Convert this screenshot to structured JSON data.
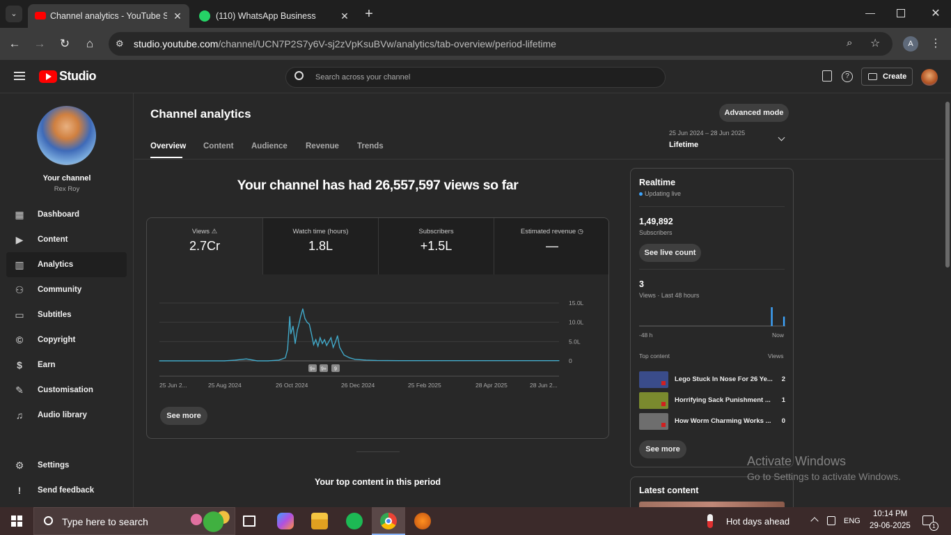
{
  "browser": {
    "tabs": [
      {
        "title": "Channel analytics - YouTube Stu",
        "close": "✕"
      },
      {
        "title": "(110) WhatsApp Business",
        "close": "✕"
      }
    ],
    "new_tab": "+",
    "url_host": "studio.youtube.com",
    "url_path": "/channel/UCN7P2S7y6V-sj2zVpKsuBVw/analytics/tab-overview/period-lifetime",
    "profile_letter": "A"
  },
  "header": {
    "logo_text": "Studio",
    "search_placeholder": "Search across your channel",
    "create_label": "Create"
  },
  "sidebar": {
    "channel_title": "Your channel",
    "channel_name": "Rex Roy",
    "items": [
      {
        "label": "Dashboard",
        "icon": "dashboard-icon"
      },
      {
        "label": "Content",
        "icon": "content-icon"
      },
      {
        "label": "Analytics",
        "icon": "analytics-icon"
      },
      {
        "label": "Community",
        "icon": "community-icon"
      },
      {
        "label": "Subtitles",
        "icon": "subtitles-icon"
      },
      {
        "label": "Copyright",
        "icon": "copyright-icon"
      },
      {
        "label": "Earn",
        "icon": "earn-icon"
      },
      {
        "label": "Customisation",
        "icon": "customisation-icon"
      },
      {
        "label": "Audio library",
        "icon": "audio-library-icon"
      }
    ],
    "settings": "Settings",
    "feedback": "Send feedback"
  },
  "main": {
    "title": "Channel analytics",
    "advanced_mode": "Advanced mode",
    "tabs": [
      "Overview",
      "Content",
      "Audience",
      "Revenue",
      "Trends"
    ],
    "date_range": "25 Jun 2024 – 28 Jun 2025",
    "period": "Lifetime",
    "headline": "Your channel has had 26,557,597 views so far",
    "metrics": [
      {
        "label": "Views",
        "value": "2.7Cr"
      },
      {
        "label": "Watch time (hours)",
        "value": "1.8L"
      },
      {
        "label": "Subscribers",
        "value": "+1.5L"
      },
      {
        "label": "Estimated revenue",
        "value": "—"
      }
    ],
    "see_more": "See more",
    "top_content_heading": "Your top content in this period"
  },
  "chart_data": {
    "type": "line",
    "y_ticks": [
      "15.0L",
      "10.0L",
      "5.0L",
      "0"
    ],
    "ylim": [
      0,
      1500000
    ],
    "x_ticks": [
      "25 Jun 2...",
      "25 Aug 2024",
      "26 Oct 2024",
      "26 Dec 2024",
      "25 Feb 2025",
      "28 Apr 2025",
      "28 Jun 2..."
    ],
    "markers": [
      "9+",
      "9+",
      "9"
    ],
    "x": [
      0,
      20,
      40,
      60,
      70,
      80,
      90,
      100,
      110,
      116,
      118,
      120,
      121,
      123,
      125,
      127,
      128,
      130,
      132,
      134,
      136,
      138,
      140,
      142,
      144,
      146,
      148,
      150,
      152,
      154,
      156,
      158,
      160,
      162,
      164,
      166,
      168,
      170,
      175,
      180,
      190,
      200,
      220,
      240,
      260,
      280,
      300,
      330,
      368
    ],
    "values": [
      0,
      0,
      0,
      0,
      20000,
      50000,
      0,
      0,
      20000,
      80000,
      300000,
      1150000,
      700000,
      900000,
      450000,
      800000,
      900000,
      1150000,
      1350000,
      1100000,
      1000000,
      950000,
      700000,
      420000,
      550000,
      380000,
      600000,
      450000,
      550000,
      400000,
      500000,
      600000,
      350000,
      480000,
      650000,
      350000,
      250000,
      150000,
      80000,
      40000,
      20000,
      10000,
      5000,
      5000,
      5000,
      5000,
      5000,
      5000,
      5000
    ]
  },
  "realtime": {
    "title": "Realtime",
    "status": "Updating live",
    "subs_value": "1,49,892",
    "subs_label": "Subscribers",
    "see_live": "See live count",
    "views_value": "3",
    "views_label": "Views · Last 48 hours",
    "left_axis": "-48 h",
    "right_axis": "Now",
    "bars": [
      0,
      0,
      0,
      0,
      0,
      0,
      0,
      0,
      0,
      0,
      0,
      0,
      0,
      0,
      0,
      0,
      0,
      0,
      0,
      0,
      0,
      0,
      0,
      0,
      0,
      0,
      0,
      0,
      0,
      0,
      0,
      0,
      0,
      0,
      0,
      0,
      0,
      0,
      0,
      0,
      0,
      0,
      0,
      2,
      0,
      0,
      0,
      1
    ],
    "top_content_label": "Top content",
    "top_views_label": "Views",
    "top": [
      {
        "title": "Lego Stuck In Nose For 26 Ye...",
        "views": "2",
        "color": "#3a4c8a"
      },
      {
        "title": "Horrifying Sack Punishment ...",
        "views": "1",
        "color": "#7a8a2e"
      },
      {
        "title": "How Worm Charming Works ...",
        "views": "0",
        "color": "#6e6e6e"
      }
    ],
    "see_more": "See more"
  },
  "latest": {
    "title": "Latest content"
  },
  "watermark": {
    "line1": "Activate Windows",
    "line2": "Go to Settings to activate Windows."
  },
  "taskbar": {
    "search_placeholder": "Type here to search",
    "weather": "Hot days ahead",
    "lang": "ENG",
    "time": "10:14 PM",
    "date": "29-06-2025",
    "notifications": "1"
  },
  "colors": {
    "accent": "#3ea6ff",
    "line": "#41a9c9",
    "yt_red": "#ff0000"
  }
}
